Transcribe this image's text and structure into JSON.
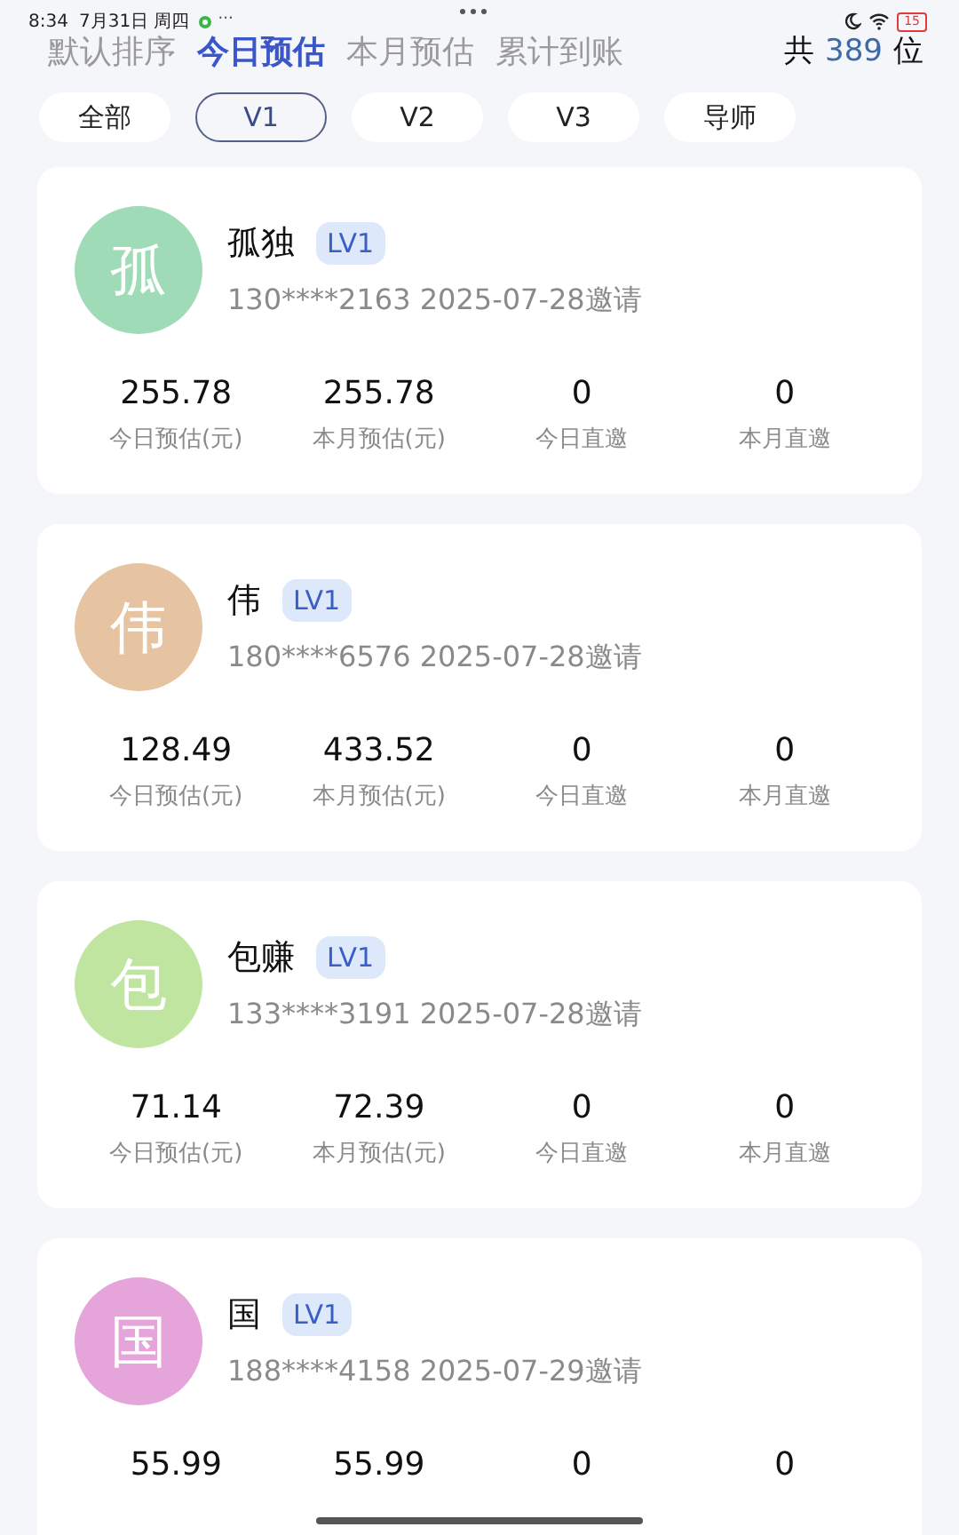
{
  "status_bar": {
    "time": "8:34",
    "date": "7月31日 周四",
    "more": "···",
    "battery": "15"
  },
  "sort_tabs": [
    {
      "label": "默认排序",
      "selected": false
    },
    {
      "label": "今日预估",
      "selected": true
    },
    {
      "label": "本月预估",
      "selected": false
    },
    {
      "label": "累计到账",
      "selected": false
    }
  ],
  "total": {
    "prefix": "共",
    "count": "389",
    "suffix": "位"
  },
  "filters": [
    {
      "label": "全部",
      "selected": false
    },
    {
      "label": "V1",
      "selected": true
    },
    {
      "label": "V2",
      "selected": false
    },
    {
      "label": "V3",
      "selected": false
    },
    {
      "label": "导师",
      "selected": false
    }
  ],
  "members": [
    {
      "avatar": "孤",
      "color": "#9edbb6",
      "name": "孤独",
      "level": "LV1",
      "info": "130****2163 2025-07-28邀请",
      "stats": [
        {
          "value": "255.78",
          "label": "今日预估(元)"
        },
        {
          "value": "255.78",
          "label": "本月预估(元)"
        },
        {
          "value": "0",
          "label": "今日直邀"
        },
        {
          "value": "0",
          "label": "本月直邀"
        }
      ]
    },
    {
      "avatar": "伟",
      "color": "#e6c3a1",
      "name": "伟",
      "level": "LV1",
      "info": "180****6576 2025-07-28邀请",
      "stats": [
        {
          "value": "128.49",
          "label": "今日预估(元)"
        },
        {
          "value": "433.52",
          "label": "本月预估(元)"
        },
        {
          "value": "0",
          "label": "今日直邀"
        },
        {
          "value": "0",
          "label": "本月直邀"
        }
      ]
    },
    {
      "avatar": "包",
      "color": "#bfe5a1",
      "name": "包赚",
      "level": "LV1",
      "info": "133****3191 2025-07-28邀请",
      "stats": [
        {
          "value": "71.14",
          "label": "今日预估(元)"
        },
        {
          "value": "72.39",
          "label": "本月预估(元)"
        },
        {
          "value": "0",
          "label": "今日直邀"
        },
        {
          "value": "0",
          "label": "本月直邀"
        }
      ]
    },
    {
      "avatar": "国",
      "color": "#e5a5da",
      "name": "国",
      "level": "LV1",
      "info": "188****4158 2025-07-29邀请",
      "stats": [
        {
          "value": "55.99"
        },
        {
          "value": "55.99"
        },
        {
          "value": "0"
        },
        {
          "value": "0"
        }
      ]
    }
  ]
}
